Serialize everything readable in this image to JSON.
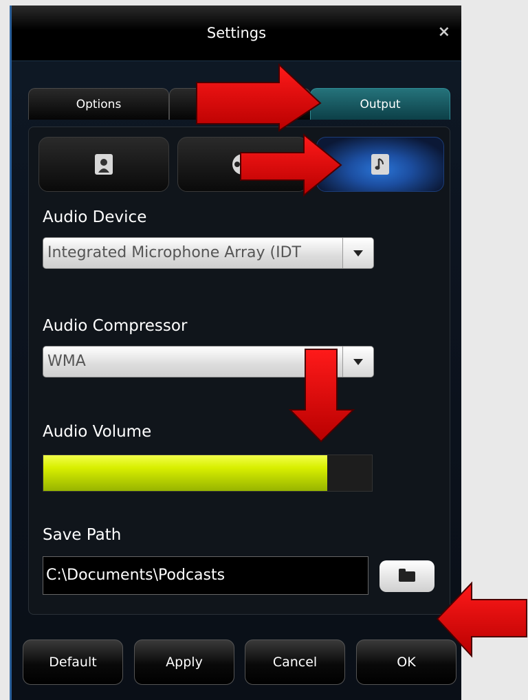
{
  "window": {
    "title": "Settings",
    "close_glyph": "×"
  },
  "tabs": [
    {
      "label": "Options",
      "active": false
    },
    {
      "label": "",
      "active": false
    },
    {
      "label": "Output",
      "active": true
    }
  ],
  "subtabs": [
    {
      "icon": "person-icon",
      "active": false
    },
    {
      "icon": "film-reel-icon",
      "active": false
    },
    {
      "icon": "music-note-icon",
      "active": true
    }
  ],
  "audio_device": {
    "label": "Audio Device",
    "value": "Integrated Microphone Array (IDT"
  },
  "audio_compressor": {
    "label": "Audio Compressor",
    "value": "WMA"
  },
  "audio_volume": {
    "label": "Audio Volume",
    "level": 0.865
  },
  "save_path": {
    "label": "Save Path",
    "value": "C:\\Documents\\Podcasts"
  },
  "buttons": {
    "default": "Default",
    "apply": "Apply",
    "cancel": "Cancel",
    "ok": "OK"
  },
  "colors": {
    "accent_tab": "#1a5c66",
    "volume_fill": "#d8ef00",
    "annotation_arrow": "#e00000"
  }
}
